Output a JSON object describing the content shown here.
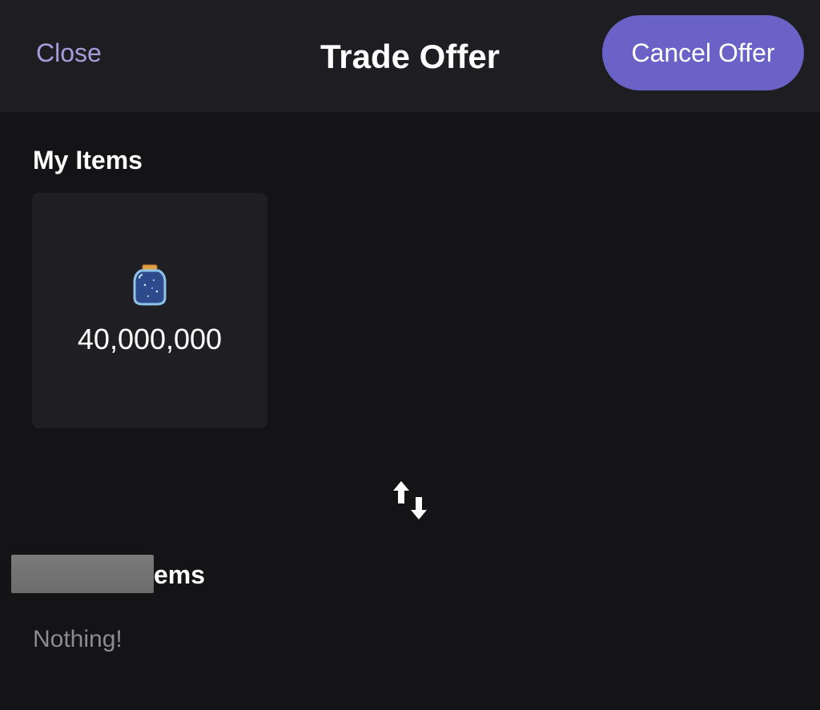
{
  "header": {
    "close_label": "Close",
    "title": "Trade Offer",
    "cancel_label": "Cancel Offer"
  },
  "my_items": {
    "heading": "My Items",
    "items": [
      {
        "icon": "jar-icon",
        "value": "40,000,000"
      }
    ]
  },
  "swap": {
    "icon": "swap-arrows-icon"
  },
  "their_items": {
    "heading_visible": "ems",
    "empty_text": "Nothing!"
  },
  "colors": {
    "accent": "#6a62c6",
    "close_text": "#a79ddd",
    "header_bg": "#1e1e22",
    "page_bg": "#141416",
    "card_bg": "#1f1e23",
    "muted_text": "#8b8b90"
  }
}
